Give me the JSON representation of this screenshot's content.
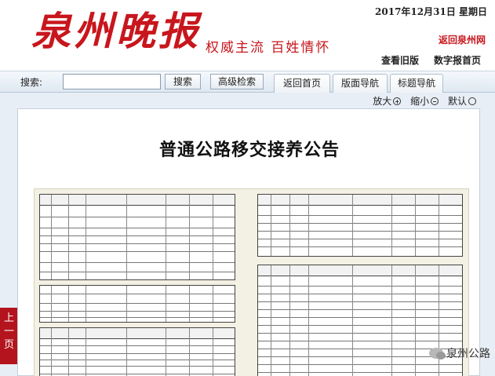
{
  "header": {
    "logo_text": "泉州晚报",
    "slogan": "权威主流  百姓情怀",
    "date": "2017年12月31日 星期日",
    "back_home": "返回泉州网",
    "old_issues": "查看旧版",
    "digital_home": "数字报首页"
  },
  "searchbar": {
    "label": "搜索:",
    "input_value": "",
    "search_button": "搜索",
    "advanced_button": "高级检索",
    "tabs": [
      "返回首页",
      "版面导航",
      "标题导航"
    ]
  },
  "zoom": {
    "enlarge": "放大",
    "shrink": "缩小",
    "default": "默认"
  },
  "article": {
    "title": "普通公路移交接养公告"
  },
  "nav": {
    "prev_page": "上一页"
  },
  "watermark": {
    "text": "泉州公路"
  },
  "colors": {
    "brand_red": "#c8161d",
    "toolbar_bg": "#dfe8f1",
    "page_bg": "#e8eef5"
  }
}
